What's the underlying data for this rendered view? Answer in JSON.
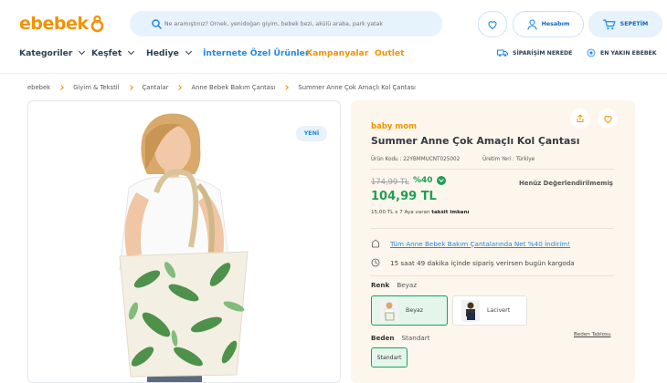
{
  "header": {
    "logo_text": "ebebek",
    "search_placeholder": "Ne aramıştınız? Örnek, yenidoğan giyim, bebek bezi, akülü araba, park yatak",
    "account_label": "Hesabım",
    "cart_label": "SEPETİM"
  },
  "nav": {
    "items": [
      {
        "label": "Kategoriler"
      },
      {
        "label": "Keşfet"
      },
      {
        "label": "Hediye"
      },
      {
        "label": "İnternete Özel Ürünler"
      },
      {
        "label": "Kampanyalar"
      },
      {
        "label": "Outlet"
      }
    ],
    "order_tracking": "SİPARİŞİM NEREDE",
    "nearest_store": "EN YAKIN EBEBEK"
  },
  "breadcrumb": [
    "ebebek",
    "Giyim & Tekstil",
    "Çantalar",
    "Anne Bebek Bakım Çantası",
    "Summer Anne Çok Amaçlı Kol Çantası"
  ],
  "product": {
    "badge": "YENİ",
    "brand": "baby mom",
    "title": "Summer Anne Çok Amaçlı Kol Çantası",
    "code": "Ürün Kodu : 22YBMMUCNT025002",
    "origin": "Üretim Yeri : Türkiye",
    "old_price": "174,99 TL",
    "discount": "%40",
    "price": "104,99 TL",
    "rating": "Henüz Değerlendirilmemiş",
    "installment_text": "15,00 TL x 7 Aya varan",
    "installment_link": "taksit imkanı",
    "promo": "Tüm Anne Bebek Bakım Çantalarında Net %40 İndirim!",
    "shipping": "15 saat 49 dakika içinde sipariş verirsen bugün kargoda",
    "color_label": "Renk",
    "color_value": "Beyaz",
    "colors": [
      "Beyaz",
      "Lacivert"
    ],
    "size_label": "Beden",
    "size_value": "Standart",
    "size_guide": "Beden Tablosu",
    "sizes": [
      "Standart"
    ]
  },
  "colors": {
    "brand_orange": "#f39200",
    "brand_blue": "#1e88e5",
    "price_green": "#1e9f55",
    "panel_bg": "#fdf6ec"
  }
}
